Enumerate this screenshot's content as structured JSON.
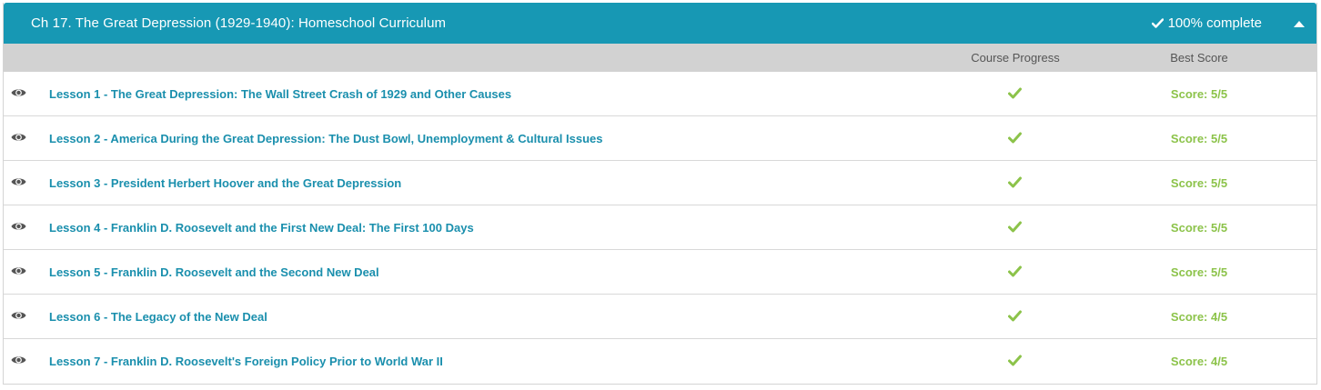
{
  "chapter": {
    "title": "Ch 17. The Great Depression (1929-1940): Homeschool Curriculum",
    "complete_label": "100% complete",
    "complete_icon": "check-icon",
    "toggle_icon": "caret-up-icon"
  },
  "columns": {
    "progress": "Course Progress",
    "score": "Best Score"
  },
  "colors": {
    "header_bg": "#1798b4",
    "link": "#1a8fad",
    "success": "#8cc34a"
  },
  "lessons": [
    {
      "label": "Lesson 1 - The Great Depression: The Wall Street Crash of 1929 and Other Causes",
      "progress_icon": "check-icon",
      "score": "Score: 5/5"
    },
    {
      "label": "Lesson 2 - America During the Great Depression: The Dust Bowl, Unemployment & Cultural Issues",
      "progress_icon": "check-icon",
      "score": "Score: 5/5"
    },
    {
      "label": "Lesson 3 - President Herbert Hoover and the Great Depression",
      "progress_icon": "check-icon",
      "score": "Score: 5/5"
    },
    {
      "label": "Lesson 4 - Franklin D. Roosevelt and the First New Deal: The First 100 Days",
      "progress_icon": "check-icon",
      "score": "Score: 5/5"
    },
    {
      "label": "Lesson 5 - Franklin D. Roosevelt and the Second New Deal",
      "progress_icon": "check-icon",
      "score": "Score: 5/5"
    },
    {
      "label": "Lesson 6 - The Legacy of the New Deal",
      "progress_icon": "check-icon",
      "score": "Score: 4/5"
    },
    {
      "label": "Lesson 7 - Franklin D. Roosevelt's Foreign Policy Prior to World War II",
      "progress_icon": "check-icon",
      "score": "Score: 4/5"
    }
  ]
}
